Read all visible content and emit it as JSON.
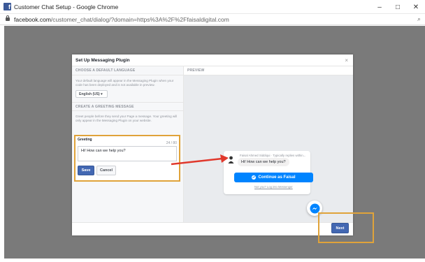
{
  "window": {
    "title": "Customer Chat Setup - Google Chrome",
    "logo_letter": "f",
    "minimize": "–",
    "maximize": "□",
    "close": "✕"
  },
  "address_bar": {
    "url_host": "facebook.com",
    "url_path": "/customer_chat/dialog/?domain=https%3A%2F%2Ffaisaldigital.com",
    "zoom_glyph": "⌕"
  },
  "dialog": {
    "title": "Set Up Messaging Plugin",
    "close": "×",
    "language_section": {
      "heading": "CHOOSE A DEFAULT LANGUAGE",
      "description": "Your default language will appear in the Messaging Plugin when your code has been deployed and is not available in preview.",
      "selected": "English (US) ▾"
    },
    "greeting_section": {
      "heading": "CREATE A GREETING MESSAGE",
      "description": "Greet people before they send your Page a message. Your greeting will only appear in the Messaging Plugin on your website.",
      "label": "Greeting",
      "count": "24 / 80",
      "value": "Hi! How can we help you?",
      "save": "Save",
      "cancel": "Cancel"
    },
    "preview": {
      "heading": "PREVIEW",
      "sender": "Faisal Ahmed Siddiqui · Typically replies within...",
      "bubble": "Hi! How can we help you?",
      "continue": "Continue as Faisal",
      "not_you": "Not you? Log into Messenger"
    },
    "next": "Next"
  },
  "colors": {
    "accent": "#4267b2",
    "messenger_blue": "#0084ff",
    "highlight": "#e0a33a",
    "arrow": "#e0382c"
  }
}
